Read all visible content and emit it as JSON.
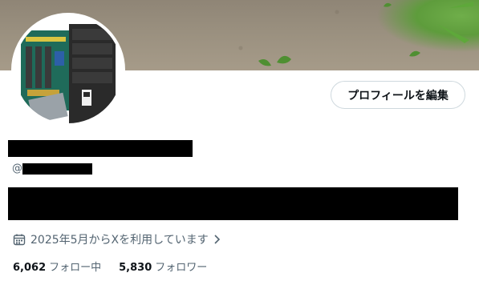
{
  "profile": {
    "edit_button_label": "プロフィールを編集",
    "handle_prefix": "@",
    "joined_text": "2025年5月からXを利用しています",
    "following_count": "6,062",
    "following_label": "フォロー中",
    "followers_count": "5,830",
    "followers_label": "フォロワー"
  },
  "icons": {
    "joined": "calendar-icon",
    "joined_more": "chevron-right-icon"
  },
  "colors": {
    "text_primary": "#0f1419",
    "text_secondary": "#536471",
    "border": "#cfd9de"
  }
}
